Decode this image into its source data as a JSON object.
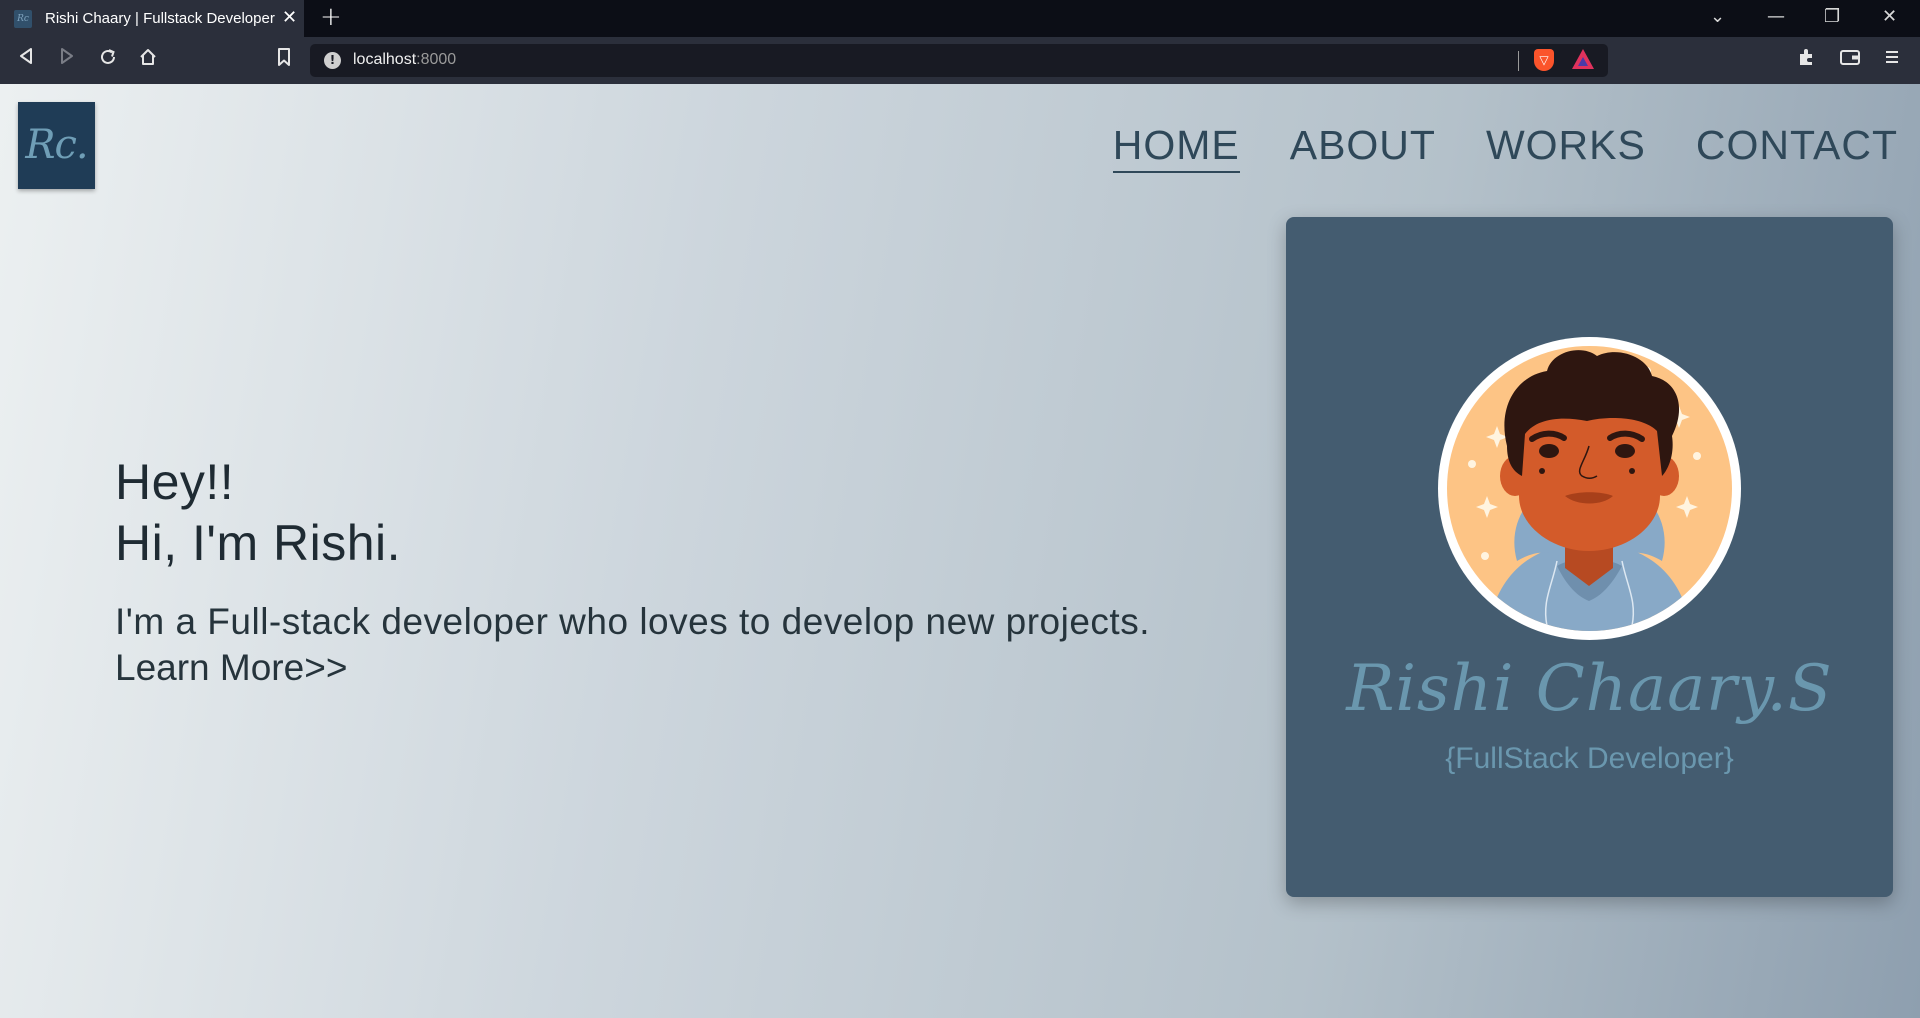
{
  "browser": {
    "tab_title": "Rishi Chaary | Fullstack Developer",
    "tab_favicon_text": "Rc",
    "tab_close_glyph": "✕",
    "new_tab_glyph": "+",
    "url_host": "localhost",
    "url_port": ":8000",
    "window_controls": [
      "⌄",
      "—",
      "❐",
      "✕"
    ],
    "toolbar_icons": [
      "back-icon",
      "forward-icon",
      "reload-icon",
      "home-icon",
      "bookmark-icon",
      "site-info-icon",
      "brave-shields-icon",
      "brave-rewards-icon",
      "extensions-icon",
      "wallet-icon",
      "menu-icon"
    ]
  },
  "site": {
    "logo_text": "Rc.",
    "nav": [
      {
        "label": "HOME",
        "active": true
      },
      {
        "label": "ABOUT",
        "active": false
      },
      {
        "label": "WORKS",
        "active": false
      },
      {
        "label": "CONTACT",
        "active": false
      }
    ],
    "hero": {
      "greeting": "Hey!!",
      "intro": "Hi, I'm Rishi.",
      "description": "I'm a Full-stack developer who loves to develop new projects.",
      "learn_more": "Learn More>>"
    },
    "card": {
      "name": "Rishi Chaary.S",
      "role": "{FullStack Developer}"
    }
  },
  "colors": {
    "nav_text": "#2f4859",
    "card_bg": "#445c70",
    "card_accent": "#6a97ae",
    "logo_bg": "#1f3c56",
    "avatar_bg": "#fdc485",
    "skin": "#d35b2a",
    "hair": "#2e1610",
    "hoodie": "#88a9c7"
  }
}
